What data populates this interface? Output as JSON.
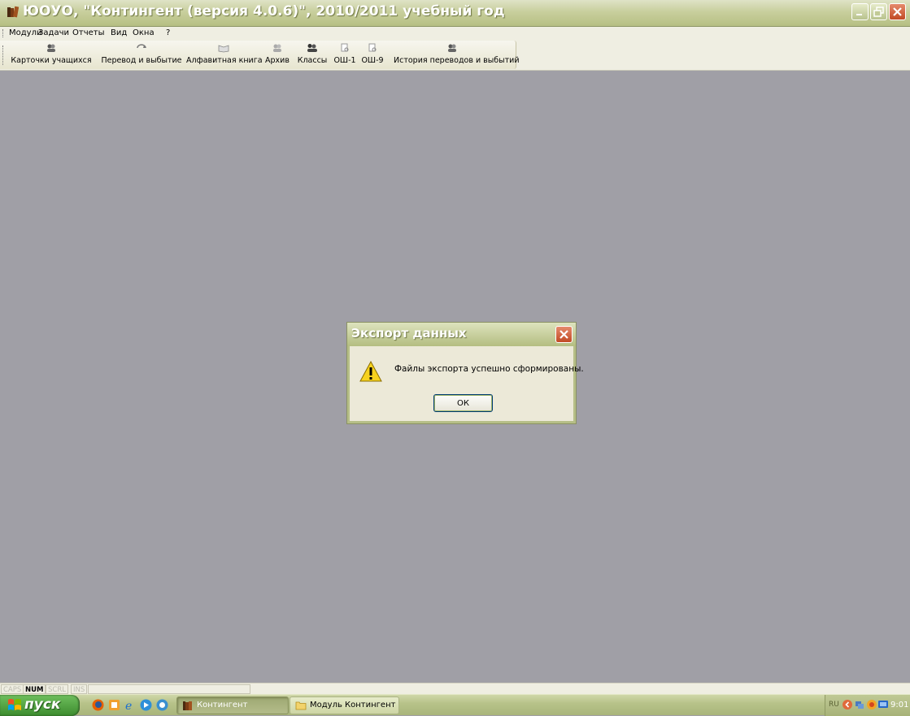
{
  "window": {
    "title": "ЮОУО, \"Контингент (версия 4.0.6)\", 2010/2011 учебный год",
    "buttons": [
      "minimize-icon",
      "restore-icon",
      "close-icon"
    ]
  },
  "menu": {
    "items": [
      "Модули",
      "Задачи",
      "Отчеты",
      "Вид",
      "Окна",
      "?"
    ]
  },
  "toolbar": {
    "buttons": [
      {
        "label": "Карточки учащихся",
        "icon": "students-icon"
      },
      {
        "label": "Перевод и выбытие",
        "icon": "transfer-icon"
      },
      {
        "label": "Алфавитная книга",
        "icon": "book-icon"
      },
      {
        "label": "Архив",
        "icon": "archive-icon"
      },
      {
        "label": "Классы",
        "icon": "classes-icon"
      },
      {
        "label": "ОШ-1",
        "icon": "report-icon"
      },
      {
        "label": "ОШ-9",
        "icon": "report-icon"
      },
      {
        "label": "История переводов и выбытий",
        "icon": "history-icon"
      }
    ]
  },
  "dialog": {
    "title": "Экспорт данных",
    "message": "Файлы экспорта успешно сформированы.",
    "ok_label": "ОК",
    "icon": "warning-icon"
  },
  "statusbar": {
    "indicators": [
      {
        "label": "CAPS",
        "active": false
      },
      {
        "label": "NUM",
        "active": true
      },
      {
        "label": "SCRL",
        "active": false
      },
      {
        "label": "INS",
        "active": false
      }
    ]
  },
  "taskbar": {
    "start_label": "пуск",
    "quick_launch": [
      "firefox-icon",
      "notes-icon",
      "ie-icon",
      "media-icon",
      "messenger-icon"
    ],
    "tasks": [
      {
        "label": "Контингент",
        "active": true,
        "icon": "app-icon"
      },
      {
        "label": "Модуль Контингент",
        "active": false,
        "icon": "folder-icon"
      }
    ],
    "tray": {
      "lang": "RU",
      "time": "9:01"
    }
  },
  "colors": {
    "titlebar": "#c8cf9d",
    "mdi_background": "#a09fa6",
    "dialog_background": "#ece9d8",
    "start_button": "#4e9e3f"
  }
}
